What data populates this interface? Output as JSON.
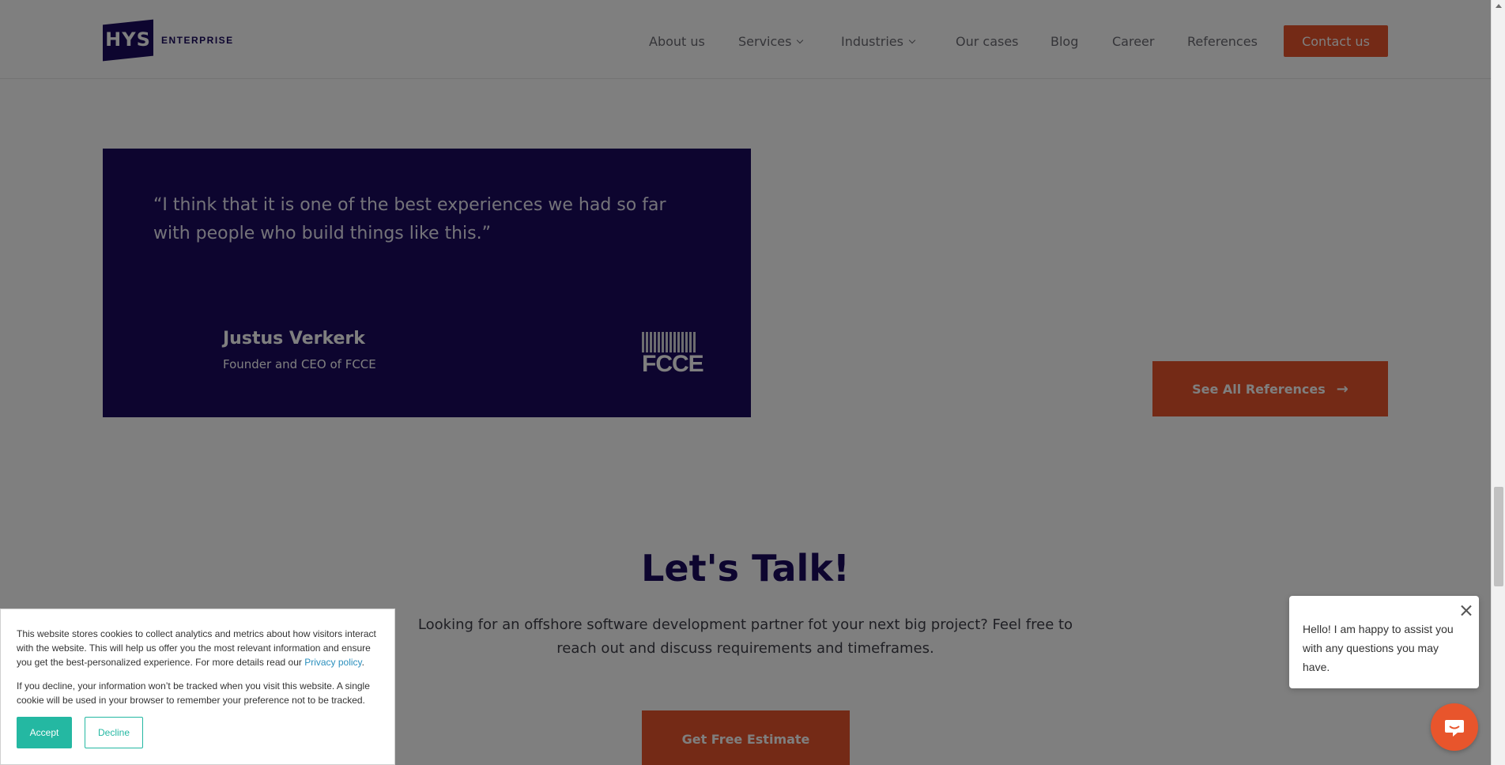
{
  "header": {
    "logo_mark": "HYS",
    "logo_word": "ENTERPRISE",
    "nav": [
      {
        "label": "About us",
        "has_dropdown": false
      },
      {
        "label": "Services",
        "has_dropdown": true
      },
      {
        "label": "Industries",
        "has_dropdown": true
      },
      {
        "label": "Our cases",
        "has_dropdown": false
      },
      {
        "label": "Blog",
        "has_dropdown": false
      },
      {
        "label": "Career",
        "has_dropdown": false
      },
      {
        "label": "References",
        "has_dropdown": false
      }
    ],
    "contact_label": "Contact us"
  },
  "testimonial": {
    "quote": "“I think that it is one of the best experiences we had so far with people who build things like this.”",
    "name": "Justus Verkerk",
    "role": "Founder and CEO of FCCE",
    "company_logo": "FCCE"
  },
  "see_all_label": "See All References",
  "talk": {
    "title": "Let's Talk!",
    "text": "Looking for an offshore software development partner fot your next big project? Feel free to reach out and discuss requirements and timeframes.",
    "button_label": "Get Free Estimate"
  },
  "cookie": {
    "text_1": "This website stores cookies to collect analytics and metrics about how visitors interact with the website. This will help us offer you the most relevant information and ensure you get the best-personalized experience. For more details read our ",
    "privacy_link": "Privacy policy",
    "text_1_end": ".",
    "text_2": "If you decline, your information won’t be tracked when you visit this website. A single cookie will be used in your browser to remember your preference not to be tracked.",
    "accept_label": "Accept",
    "decline_label": "Decline"
  },
  "chat": {
    "message": "Hello! I am happy to assist you with any questions you may have."
  },
  "colors": {
    "brand_navy": "#1a0a5e",
    "accent_orange": "#e8552c",
    "cookie_teal": "#24b8a2"
  }
}
